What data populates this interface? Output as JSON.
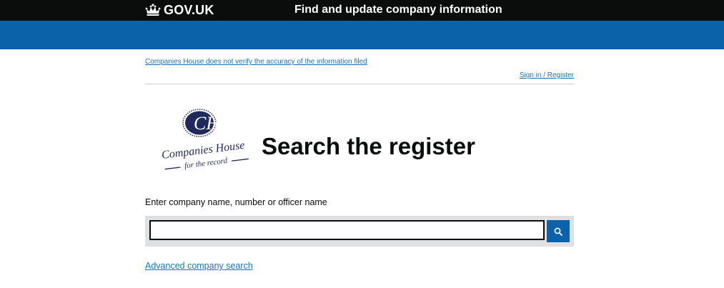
{
  "header": {
    "logo_text": "GOV.UK",
    "service_name": "Find and update company information"
  },
  "notice": {
    "disclaimer": "Companies House does not verify the accuracy of the information filed",
    "signin": "Sign in / Register"
  },
  "brand": {
    "monogram": "CH",
    "name": "Companies House",
    "tagline": "for the record"
  },
  "main": {
    "title": "Search the register",
    "search_label": "Enter company name, number or officer name",
    "search_value": "",
    "advanced_link": "Advanced company search"
  },
  "icons": {
    "crown": "crown-icon",
    "search": "search-icon"
  },
  "colors": {
    "header_black": "#0b0c0c",
    "band_blue": "#0b62a8",
    "link_blue": "#1d70b8",
    "panel_grey": "#dee0e2",
    "brand_navy": "#1f2a5c"
  }
}
